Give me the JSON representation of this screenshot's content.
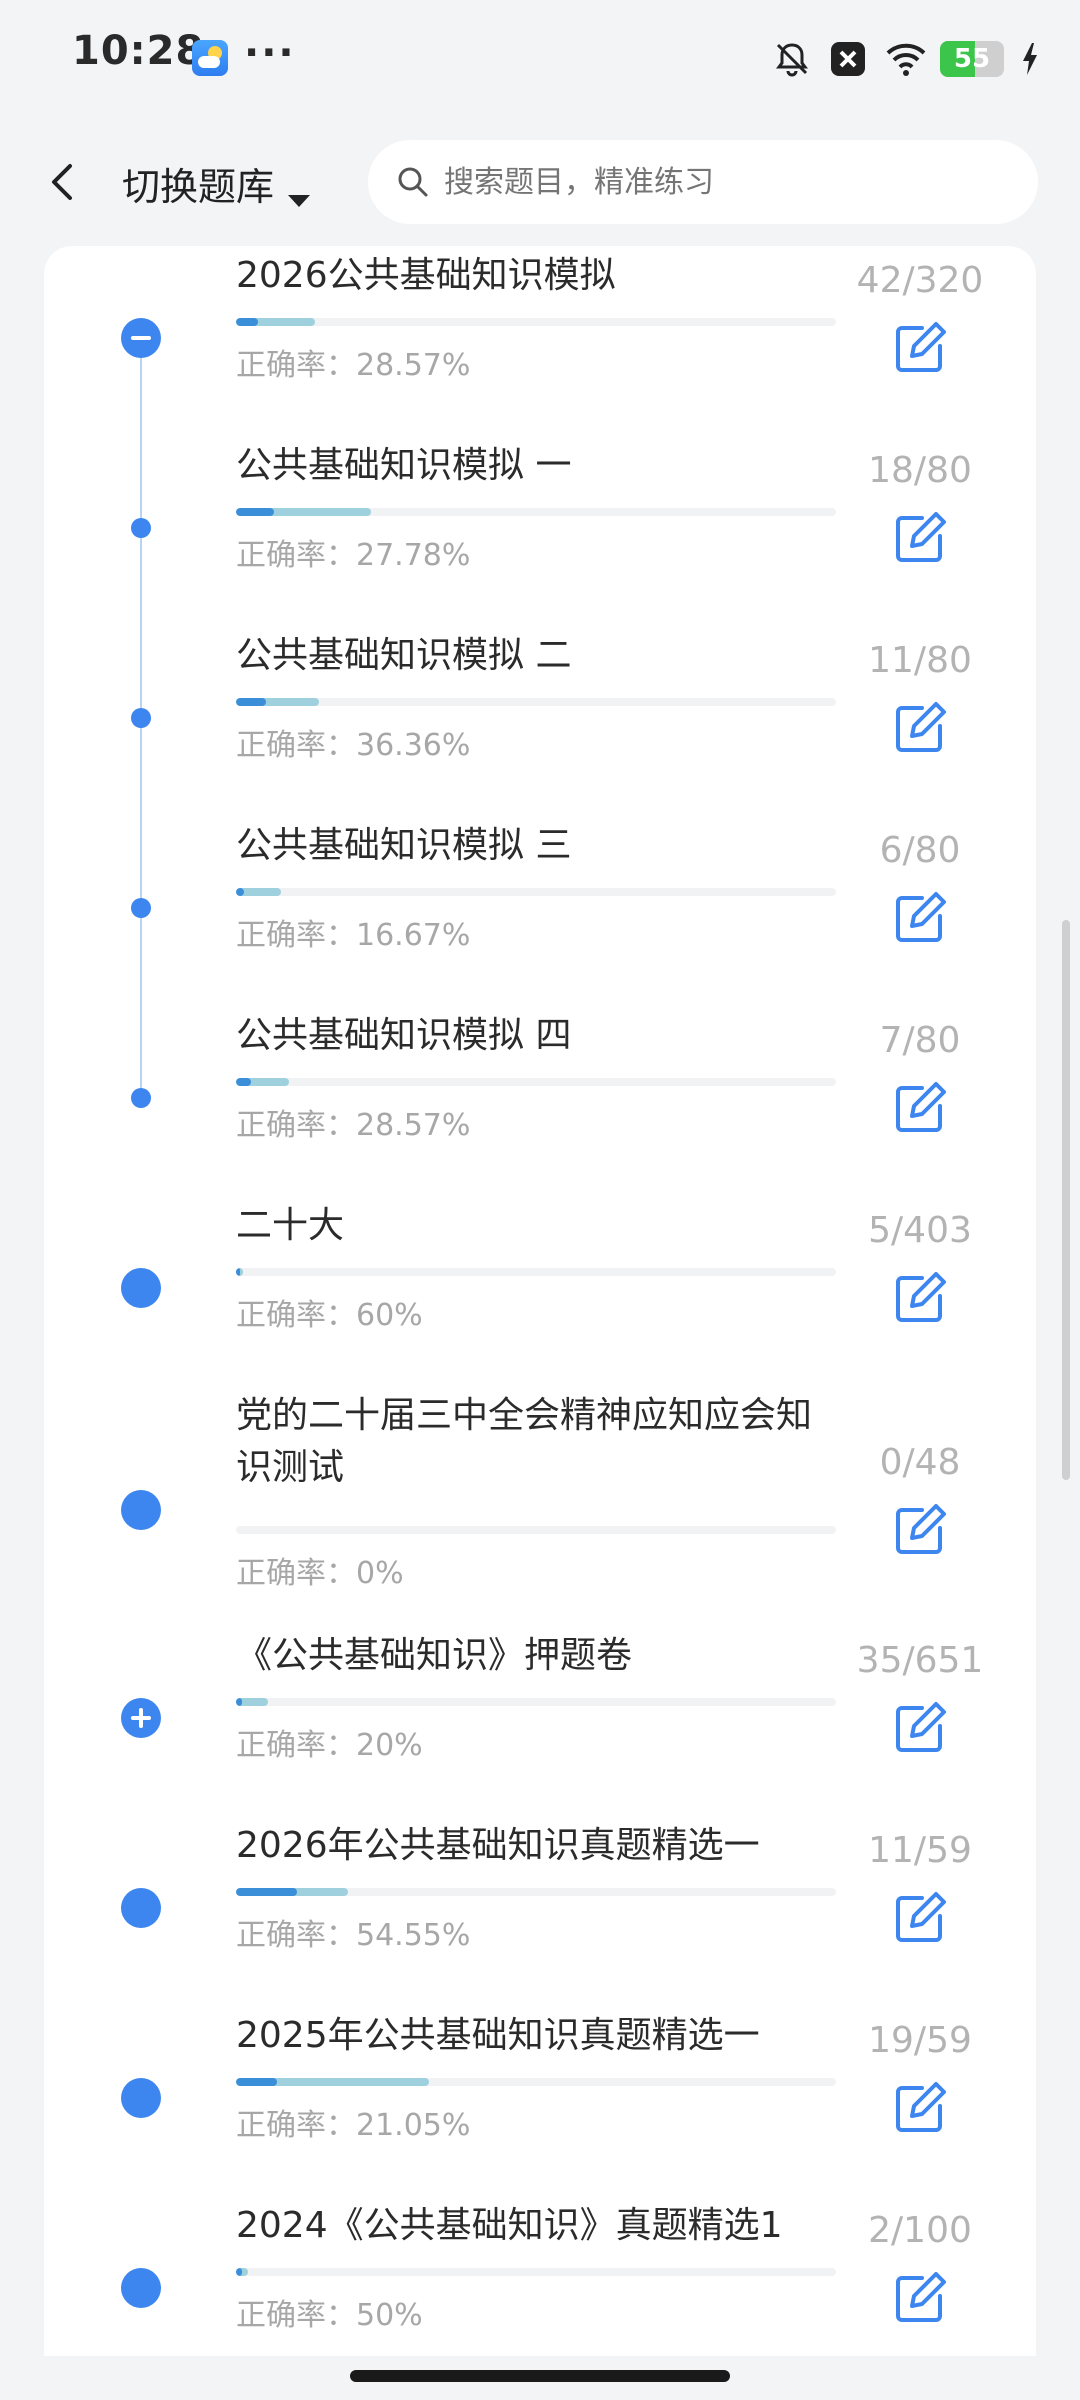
{
  "status": {
    "time": "10:28",
    "more": "···",
    "battery": "55"
  },
  "header": {
    "library_label": "切换题库",
    "search_placeholder": "搜索题目，精准练习"
  },
  "items": [
    {
      "title": "2026公共基础知识模拟",
      "count": "42/320",
      "accuracy_label": "正确率：",
      "accuracy": "28.57%",
      "progress": 0.131,
      "correct_fraction": 0.286,
      "marker": "minus"
    },
    {
      "title": "公共基础知识模拟 一",
      "count": "18/80",
      "accuracy_label": "正确率：",
      "accuracy": "27.78%",
      "progress": 0.225,
      "correct_fraction": 0.278,
      "marker": "dot"
    },
    {
      "title": "公共基础知识模拟 二",
      "count": "11/80",
      "accuracy_label": "正确率：",
      "accuracy": "36.36%",
      "progress": 0.138,
      "correct_fraction": 0.364,
      "marker": "dot"
    },
    {
      "title": "公共基础知识模拟 三",
      "count": "6/80",
      "accuracy_label": "正确率：",
      "accuracy": "16.67%",
      "progress": 0.075,
      "correct_fraction": 0.167,
      "marker": "dot"
    },
    {
      "title": "公共基础知识模拟 四",
      "count": "7/80",
      "accuracy_label": "正确率：",
      "accuracy": "28.57%",
      "progress": 0.088,
      "correct_fraction": 0.286,
      "marker": "dot"
    },
    {
      "title": "二十大",
      "count": "5/403",
      "accuracy_label": "正确率：",
      "accuracy": "60%",
      "progress": 0.012,
      "correct_fraction": 0.6,
      "marker": "big"
    },
    {
      "title": "党的二十届三中全会精神应知应会知识测试",
      "count": "0/48",
      "accuracy_label": "正确率：",
      "accuracy": "0%",
      "progress": 0.0,
      "correct_fraction": 0.0,
      "marker": "big"
    },
    {
      "title": "《公共基础知识》押题卷",
      "count": "35/651",
      "accuracy_label": "正确率：",
      "accuracy": "20%",
      "progress": 0.054,
      "correct_fraction": 0.2,
      "marker": "plus"
    },
    {
      "title": "2026年公共基础知识真题精选一",
      "count": "11/59",
      "accuracy_label": "正确率：",
      "accuracy": "54.55%",
      "progress": 0.186,
      "correct_fraction": 0.545,
      "marker": "big"
    },
    {
      "title": "2025年公共基础知识真题精选一",
      "count": "19/59",
      "accuracy_label": "正确率：",
      "accuracy": "21.05%",
      "progress": 0.322,
      "correct_fraction": 0.21,
      "marker": "big"
    },
    {
      "title": "2024《公共基础知识》真题精选1",
      "count": "2/100",
      "accuracy_label": "正确率：",
      "accuracy": "50%",
      "progress": 0.02,
      "correct_fraction": 0.5,
      "marker": "big"
    }
  ],
  "colors": {
    "accent": "#3d86f0",
    "progress_answered": "#9fd0de",
    "progress_correct": "#3b8fd8"
  }
}
